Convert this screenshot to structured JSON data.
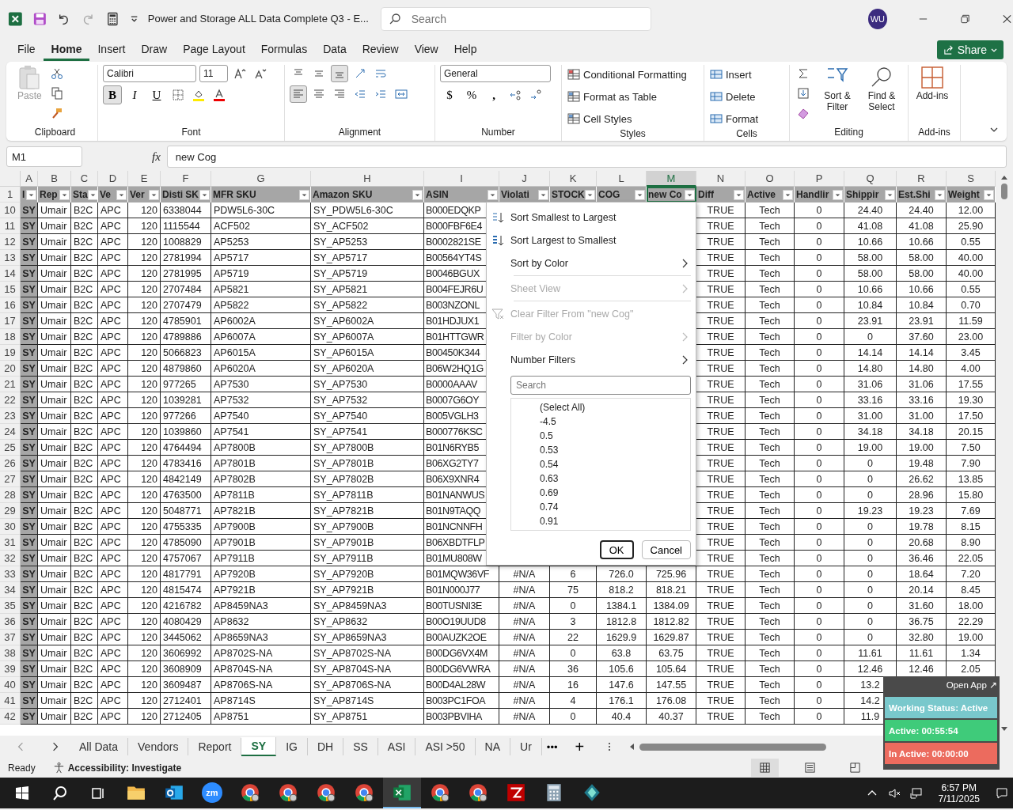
{
  "window": {
    "title": "Power and Storage ALL Data Complete Q3  -  E...",
    "search": {
      "placeholder": "Search"
    },
    "avatar": "WU"
  },
  "menu_tabs": [
    {
      "label": "File",
      "selected": false
    },
    {
      "label": "Home",
      "selected": true
    },
    {
      "label": "Insert",
      "selected": false
    },
    {
      "label": "Draw",
      "selected": false
    },
    {
      "label": "Page Layout",
      "selected": false
    },
    {
      "label": "Formulas",
      "selected": false
    },
    {
      "label": "Data",
      "selected": false
    },
    {
      "label": "Review",
      "selected": false
    },
    {
      "label": "View",
      "selected": false
    },
    {
      "label": "Help",
      "selected": false
    }
  ],
  "share": "Share",
  "ribbon": {
    "clipboard": {
      "paste": "Paste",
      "label": "Clipboard"
    },
    "font": {
      "family": "Calibri",
      "size": "11",
      "bold": "B",
      "italic": "I",
      "underline": "U",
      "bold_on": true,
      "label": "Font"
    },
    "alignment": {
      "left_on": true,
      "bottom_on": true,
      "label": "Alignment"
    },
    "number": {
      "format": "General",
      "currency": "$",
      "percent": "%",
      "comma": ",",
      "label": "Number"
    },
    "styles": {
      "items": [
        "Conditional Formatting",
        "Format as Table",
        "Cell Styles"
      ],
      "label": "Styles"
    },
    "cells": {
      "items": [
        "Insert",
        "Delete",
        "Format"
      ],
      "label": "Cells"
    },
    "editing": {
      "sort": "Sort & Filter",
      "find": "Find & Select",
      "label": "Editing"
    },
    "addins": {
      "button": "Add-ins",
      "label": "Add-ins"
    }
  },
  "formula_bar": {
    "name_box": "M1",
    "fx": "fx",
    "value": "new Cog"
  },
  "columns": [
    {
      "letter": "A",
      "selected": false
    },
    {
      "letter": "B",
      "selected": false
    },
    {
      "letter": "C",
      "selected": false
    },
    {
      "letter": "D",
      "selected": false
    },
    {
      "letter": "E",
      "selected": false
    },
    {
      "letter": "F",
      "selected": false
    },
    {
      "letter": "G",
      "selected": false
    },
    {
      "letter": "H",
      "selected": false
    },
    {
      "letter": "I",
      "selected": false
    },
    {
      "letter": "J",
      "selected": false
    },
    {
      "letter": "K",
      "selected": false
    },
    {
      "letter": "L",
      "selected": false
    },
    {
      "letter": "M",
      "selected": true
    },
    {
      "letter": "N",
      "selected": false
    },
    {
      "letter": "O",
      "selected": false
    },
    {
      "letter": "P",
      "selected": false
    },
    {
      "letter": "Q",
      "selected": false
    },
    {
      "letter": "R",
      "selected": false
    },
    {
      "letter": "S",
      "selected": false
    }
  ],
  "header_row": {
    "n": "1",
    "cells": [
      "I",
      "Rep",
      "Sta",
      "Ve",
      "Ver",
      "Disti SK",
      "MFR SKU",
      "Amazon SKU",
      "ASIN",
      "Violati",
      "STOCK",
      "COG",
      "new Co",
      "Diff",
      "Active",
      "Handlir",
      "Shippir",
      "Est.Shi",
      "Weight"
    ]
  },
  "rows": [
    {
      "n": "10",
      "cells": [
        "SY",
        "Umair",
        "B2C",
        "APC",
        "120",
        "6338044",
        "PDW5L6-30C",
        "SY_PDW5L6-30C",
        "B000EDQKP",
        null,
        null,
        null,
        null,
        "TRUE",
        "Tech",
        "0",
        "24.40",
        "24.40",
        "12.00"
      ]
    },
    {
      "n": "11",
      "cells": [
        "SY",
        "Umair",
        "B2C",
        "APC",
        "120",
        "1115544",
        "ACF502",
        "SY_ACF502",
        "B000FBF6E4",
        null,
        null,
        null,
        null,
        "TRUE",
        "Tech",
        "0",
        "41.08",
        "41.08",
        "25.90"
      ]
    },
    {
      "n": "12",
      "cells": [
        "SY",
        "Umair",
        "B2C",
        "APC",
        "120",
        "1008829",
        "AP5253",
        "SY_AP5253",
        "B0002821SE",
        null,
        null,
        null,
        null,
        "TRUE",
        "Tech",
        "0",
        "10.66",
        "10.66",
        "0.55"
      ]
    },
    {
      "n": "13",
      "cells": [
        "SY",
        "Umair",
        "B2C",
        "APC",
        "120",
        "2781994",
        "AP5717",
        "SY_AP5717",
        "B00564YT4S",
        null,
        null,
        null,
        null,
        "TRUE",
        "Tech",
        "0",
        "58.00",
        "58.00",
        "40.00"
      ]
    },
    {
      "n": "14",
      "cells": [
        "SY",
        "Umair",
        "B2C",
        "APC",
        "120",
        "2781995",
        "AP5719",
        "SY_AP5719",
        "B0046BGUX",
        null,
        null,
        null,
        null,
        "TRUE",
        "Tech",
        "0",
        "58.00",
        "58.00",
        "40.00"
      ]
    },
    {
      "n": "15",
      "cells": [
        "SY",
        "Umair",
        "B2C",
        "APC",
        "120",
        "2707484",
        "AP5821",
        "SY_AP5821",
        "B004FEJR6U",
        null,
        null,
        null,
        null,
        "TRUE",
        "Tech",
        "0",
        "10.66",
        "10.66",
        "0.55"
      ]
    },
    {
      "n": "16",
      "cells": [
        "SY",
        "Umair",
        "B2C",
        "APC",
        "120",
        "2707479",
        "AP5822",
        "SY_AP5822",
        "B003NZONL",
        null,
        null,
        null,
        null,
        "TRUE",
        "Tech",
        "0",
        "10.84",
        "10.84",
        "0.70"
      ]
    },
    {
      "n": "17",
      "cells": [
        "SY",
        "Umair",
        "B2C",
        "APC",
        "120",
        "4785901",
        "AP6002A",
        "SY_AP6002A",
        "B01HDJUX1",
        null,
        null,
        null,
        null,
        "TRUE",
        "Tech",
        "0",
        "23.91",
        "23.91",
        "11.59"
      ]
    },
    {
      "n": "18",
      "cells": [
        "SY",
        "Umair",
        "B2C",
        "APC",
        "120",
        "4789886",
        "AP6007A",
        "SY_AP6007A",
        "B01HTTGWR",
        null,
        null,
        null,
        null,
        "TRUE",
        "Tech",
        "0",
        "0",
        "37.60",
        "23.00"
      ]
    },
    {
      "n": "19",
      "cells": [
        "SY",
        "Umair",
        "B2C",
        "APC",
        "120",
        "5066823",
        "AP6015A",
        "SY_AP6015A",
        "B00450K344",
        null,
        null,
        null,
        null,
        "TRUE",
        "Tech",
        "0",
        "14.14",
        "14.14",
        "3.45"
      ]
    },
    {
      "n": "20",
      "cells": [
        "SY",
        "Umair",
        "B2C",
        "APC",
        "120",
        "4879860",
        "AP6020A",
        "SY_AP6020A",
        "B06W2HQ1G",
        null,
        null,
        null,
        null,
        "TRUE",
        "Tech",
        "0",
        "14.80",
        "14.80",
        "4.00"
      ]
    },
    {
      "n": "21",
      "cells": [
        "SY",
        "Umair",
        "B2C",
        "APC",
        "120",
        "977265",
        "AP7530",
        "SY_AP7530",
        "B0000AAAV",
        null,
        null,
        null,
        null,
        "TRUE",
        "Tech",
        "0",
        "31.06",
        "31.06",
        "17.55"
      ]
    },
    {
      "n": "22",
      "cells": [
        "SY",
        "Umair",
        "B2C",
        "APC",
        "120",
        "1039281",
        "AP7532",
        "SY_AP7532",
        "B0007G6OY",
        null,
        null,
        null,
        null,
        "TRUE",
        "Tech",
        "0",
        "33.16",
        "33.16",
        "19.30"
      ]
    },
    {
      "n": "23",
      "cells": [
        "SY",
        "Umair",
        "B2C",
        "APC",
        "120",
        "977266",
        "AP7540",
        "SY_AP7540",
        "B005VGLH3",
        null,
        null,
        null,
        null,
        "TRUE",
        "Tech",
        "0",
        "31.00",
        "31.00",
        "17.50"
      ]
    },
    {
      "n": "24",
      "cells": [
        "SY",
        "Umair",
        "B2C",
        "APC",
        "120",
        "1039860",
        "AP7541",
        "SY_AP7541",
        "B000776KSC",
        null,
        null,
        null,
        null,
        "TRUE",
        "Tech",
        "0",
        "34.18",
        "34.18",
        "20.15"
      ]
    },
    {
      "n": "25",
      "cells": [
        "SY",
        "Umair",
        "B2C",
        "APC",
        "120",
        "4764494",
        "AP7800B",
        "SY_AP7800B",
        "B01N6RYB5",
        null,
        null,
        null,
        null,
        "TRUE",
        "Tech",
        "0",
        "19.00",
        "19.00",
        "7.50"
      ]
    },
    {
      "n": "26",
      "cells": [
        "SY",
        "Umair",
        "B2C",
        "APC",
        "120",
        "4783416",
        "AP7801B",
        "SY_AP7801B",
        "B06XG2TY7",
        null,
        null,
        null,
        null,
        "TRUE",
        "Tech",
        "0",
        "0",
        "19.48",
        "7.90"
      ]
    },
    {
      "n": "27",
      "cells": [
        "SY",
        "Umair",
        "B2C",
        "APC",
        "120",
        "4842149",
        "AP7802B",
        "SY_AP7802B",
        "B06X9XNR4",
        null,
        null,
        null,
        null,
        "TRUE",
        "Tech",
        "0",
        "0",
        "26.62",
        "13.85"
      ]
    },
    {
      "n": "28",
      "cells": [
        "SY",
        "Umair",
        "B2C",
        "APC",
        "120",
        "4763500",
        "AP7811B",
        "SY_AP7811B",
        "B01NANWUS",
        null,
        null,
        null,
        null,
        "TRUE",
        "Tech",
        "0",
        "0",
        "28.96",
        "15.80"
      ]
    },
    {
      "n": "29",
      "cells": [
        "SY",
        "Umair",
        "B2C",
        "APC",
        "120",
        "5048771",
        "AP7821B",
        "SY_AP7821B",
        "B01N9TAQQ",
        null,
        null,
        null,
        null,
        "TRUE",
        "Tech",
        "0",
        "19.23",
        "19.23",
        "7.69"
      ]
    },
    {
      "n": "30",
      "cells": [
        "SY",
        "Umair",
        "B2C",
        "APC",
        "120",
        "4755335",
        "AP7900B",
        "SY_AP7900B",
        "B01NCNNFH",
        null,
        null,
        null,
        null,
        "TRUE",
        "Tech",
        "0",
        "0",
        "19.78",
        "8.15"
      ]
    },
    {
      "n": "31",
      "cells": [
        "SY",
        "Umair",
        "B2C",
        "APC",
        "120",
        "4785090",
        "AP7901B",
        "SY_AP7901B",
        "B06XBDTFLP",
        null,
        null,
        null,
        null,
        "TRUE",
        "Tech",
        "0",
        "0",
        "20.68",
        "8.90"
      ]
    },
    {
      "n": "32",
      "cells": [
        "SY",
        "Umair",
        "B2C",
        "APC",
        "120",
        "4757067",
        "AP7911B",
        "SY_AP7911B",
        "B01MU808W",
        null,
        null,
        null,
        null,
        "TRUE",
        "Tech",
        "0",
        "0",
        "36.46",
        "22.05"
      ]
    },
    {
      "n": "33",
      "cells": [
        "SY",
        "Umair",
        "B2C",
        "APC",
        "120",
        "4817791",
        "AP7920B",
        "SY_AP7920B",
        "B01MQW36VF",
        "#N/A",
        "6",
        "726.0",
        "725.96",
        "TRUE",
        "Tech",
        "0",
        "0",
        "18.64",
        "7.20"
      ]
    },
    {
      "n": "34",
      "cells": [
        "SY",
        "Umair",
        "B2C",
        "APC",
        "120",
        "4815474",
        "AP7921B",
        "SY_AP7921B",
        "B01N000J77",
        "#N/A",
        "75",
        "818.2",
        "818.21",
        "TRUE",
        "Tech",
        "0",
        "0",
        "20.14",
        "8.45"
      ]
    },
    {
      "n": "35",
      "cells": [
        "SY",
        "Umair",
        "B2C",
        "APC",
        "120",
        "4216782",
        "AP8459NA3",
        "SY_AP8459NA3",
        "B00TUSNI3E",
        "#N/A",
        "0",
        "1384.1",
        "1384.09",
        "TRUE",
        "Tech",
        "0",
        "0",
        "31.60",
        "18.00"
      ]
    },
    {
      "n": "36",
      "cells": [
        "SY",
        "Umair",
        "B2C",
        "APC",
        "120",
        "4080429",
        "AP8632",
        "SY_AP8632",
        "B00O19UUD8",
        "#N/A",
        "3",
        "1812.8",
        "1812.82",
        "TRUE",
        "Tech",
        "0",
        "0",
        "36.75",
        "22.29"
      ]
    },
    {
      "n": "37",
      "cells": [
        "SY",
        "Umair",
        "B2C",
        "APC",
        "120",
        "3445062",
        "AP8659NA3",
        "SY_AP8659NA3",
        "B00AUZK2OE",
        "#N/A",
        "22",
        "1629.9",
        "1629.87",
        "TRUE",
        "Tech",
        "0",
        "0",
        "32.80",
        "19.00"
      ]
    },
    {
      "n": "38",
      "cells": [
        "SY",
        "Umair",
        "B2C",
        "APC",
        "120",
        "3606992",
        "AP8702S-NA",
        "SY_AP8702S-NA",
        "B00DG6VX4M",
        "#N/A",
        "0",
        "63.8",
        "63.75",
        "TRUE",
        "Tech",
        "0",
        "11.61",
        "11.61",
        "1.34"
      ]
    },
    {
      "n": "39",
      "cells": [
        "SY",
        "Umair",
        "B2C",
        "APC",
        "120",
        "3608909",
        "AP8704S-NA",
        "SY_AP8704S-NA",
        "B00DG6VWRA",
        "#N/A",
        "36",
        "105.6",
        "105.64",
        "TRUE",
        "Tech",
        "0",
        "12.46",
        "12.46",
        "2.05"
      ]
    },
    {
      "n": "40",
      "cells": [
        "SY",
        "Umair",
        "B2C",
        "APC",
        "120",
        "3609487",
        "AP8706S-NA",
        "SY_AP8706S-NA",
        "B00D4AL28W",
        "#N/A",
        "16",
        "147.6",
        "147.55",
        "TRUE",
        "Tech",
        "0",
        "13.2",
        null,
        null
      ]
    },
    {
      "n": "41",
      "cells": [
        "SY",
        "Umair",
        "B2C",
        "APC",
        "120",
        "2712401",
        "AP8714S",
        "SY_AP8714S",
        "B003PC1FOA",
        "#N/A",
        "4",
        "176.1",
        "176.08",
        "TRUE",
        "Tech",
        "0",
        "14.2",
        null,
        null
      ]
    },
    {
      "n": "42",
      "cells": [
        "SY",
        "Umair",
        "B2C",
        "APC",
        "120",
        "2712405",
        "AP8751",
        "SY_AP8751",
        "B003PBVIHA",
        "#N/A",
        "0",
        "40.4",
        "40.37",
        "TRUE",
        "Tech",
        "0",
        "11.9",
        null,
        null
      ]
    }
  ],
  "filter_menu": {
    "items": [
      {
        "kind": "sort_asc",
        "label": "Sort Smallest to Largest",
        "disabled": false
      },
      {
        "kind": "sort_desc",
        "label": "Sort Largest to Smallest",
        "disabled": false
      },
      {
        "kind": "submenu",
        "label": "Sort by Color",
        "disabled": false
      },
      {
        "kind": "separator"
      },
      {
        "kind": "submenu",
        "label": "Sheet View",
        "disabled": true
      },
      {
        "kind": "separator"
      },
      {
        "kind": "clear",
        "label": "Clear Filter From \"new Cog\"",
        "disabled": true
      },
      {
        "kind": "submenu",
        "label": "Filter by Color",
        "disabled": true
      },
      {
        "kind": "submenu",
        "label": "Number Filters",
        "disabled": false
      }
    ],
    "search": {
      "placeholder": "Search"
    },
    "values": [
      "(Select All)",
      "-4.5",
      "0.5",
      "0.53",
      "0.54",
      "0.63",
      "0.69",
      "0.74",
      "0.91"
    ],
    "ok": "OK",
    "cancel": "Cancel"
  },
  "sheet_tabs": [
    {
      "label": "All Data",
      "selected": false
    },
    {
      "label": "Vendors",
      "selected": false
    },
    {
      "label": "Report",
      "selected": false
    },
    {
      "label": "SY",
      "selected": true
    },
    {
      "label": "IG",
      "selected": false
    },
    {
      "label": "DH",
      "selected": false
    },
    {
      "label": "SS",
      "selected": false
    },
    {
      "label": "ASI",
      "selected": false
    },
    {
      "label": "ASI >50",
      "selected": false
    },
    {
      "label": "NA",
      "selected": false
    },
    {
      "label": "Ur",
      "selected": false
    }
  ],
  "more_tabs": "•••",
  "add_sheet": "+",
  "status_bar": {
    "ready": "Ready",
    "accessibility": "Accessibility: Investigate"
  },
  "tracker": {
    "open": "Open App ↗",
    "status": "Working Status: Active",
    "active": "Active: 00:55:54",
    "inactive": "In Active: 00:00:00"
  },
  "taskbar": {
    "apps": [
      {
        "kind": "folder",
        "active": false
      },
      {
        "kind": "mail",
        "active": false
      },
      {
        "kind": "video",
        "label": "zm",
        "active": false
      },
      {
        "kind": "browser",
        "active": false
      },
      {
        "kind": "browser",
        "active": false
      },
      {
        "kind": "browser",
        "active": false
      },
      {
        "kind": "browser",
        "active": false
      },
      {
        "kind": "sheet",
        "active": true
      },
      {
        "kind": "browser",
        "active": false
      },
      {
        "kind": "browser",
        "active": false
      },
      {
        "kind": "ftp",
        "active": false
      },
      {
        "kind": "calc",
        "active": false
      },
      {
        "kind": "gem",
        "active": false
      }
    ],
    "time": "6:57 PM",
    "date": "7/11/2025"
  }
}
